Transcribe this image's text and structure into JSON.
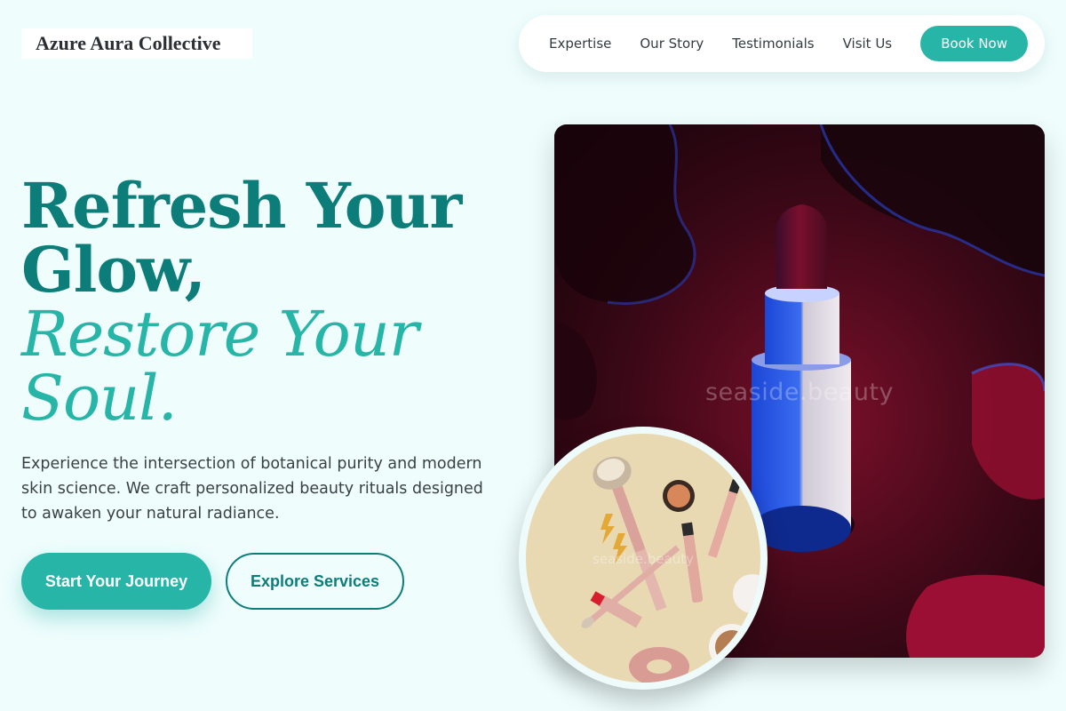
{
  "brand": {
    "name": "Azure Aura Collective"
  },
  "nav": {
    "links": [
      "Expertise",
      "Our Story",
      "Testimonials",
      "Visit Us"
    ],
    "cta": "Book Now"
  },
  "hero": {
    "headline_line1": "Refresh Your",
    "headline_line2": "Glow,",
    "headline_italic1": "Restore Your",
    "headline_italic2": "Soul.",
    "lead": "Experience the intersection of botanical purity and modern skin science. We craft personalized beauty rituals designed to awaken your natural radiance.",
    "primary_button": "Start Your Journey",
    "secondary_button": "Explore Services"
  },
  "images": {
    "main_watermark": "seaside.beauty",
    "circle_watermark": "seaside.beauty"
  },
  "colors": {
    "background": "#effdfd",
    "accent": "#27b5a8",
    "accent_dark": "#0d7d7a"
  }
}
